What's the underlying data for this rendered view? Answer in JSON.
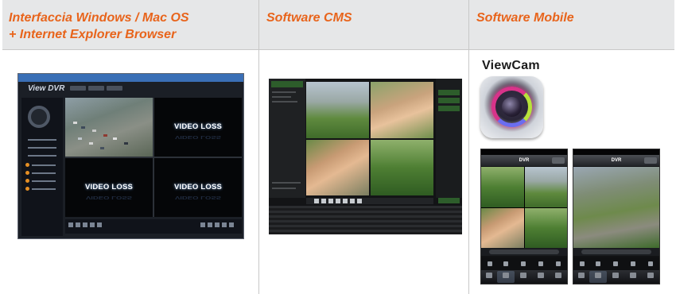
{
  "columns": [
    {
      "title_line1": "Interfaccia Windows / Mac OS",
      "title_line2": "+ Internet Explorer Browser"
    },
    {
      "title_line1": "Software CMS"
    },
    {
      "title_line1": "Software Mobile"
    }
  ],
  "dvr_client": {
    "logo": "View DVR",
    "video_loss_label": "VIDEO LOSS"
  },
  "mobile": {
    "app_name": "ViewCam",
    "phone_title": "DVR"
  },
  "colors": {
    "header_text": "#e8641b",
    "header_bg": "#e6e7e8",
    "grid_lines": "#c8c8c8"
  }
}
